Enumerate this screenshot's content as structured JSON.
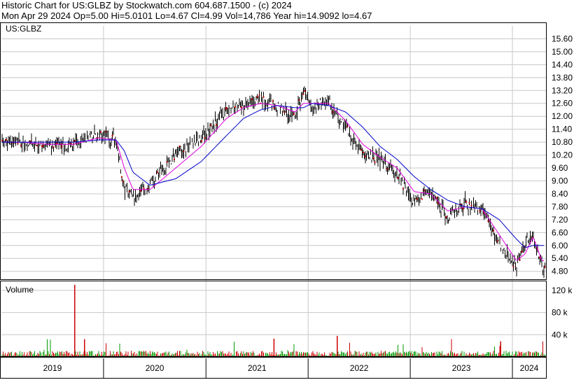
{
  "header": {
    "line1": "Historic Chart for US:GLBZ by Stockwatch.com 604.687.1500 - (c) 2024",
    "line2": "Mon Apr 29 2024  Op=5.00  Hi=5.0101  Lo=4.67  Cl=4.99  Vol=14,786  Year hi=14.9092  lo=4.67"
  },
  "colors": {
    "price_bar": "#000000",
    "down_dot": "#cc0000",
    "ma_short": "#e000e0",
    "ma_long": "#0000cc",
    "vol_up": "#009900",
    "vol_down": "#cc0000",
    "grid": "#c8c8c8"
  },
  "chart_data": [
    {
      "type": "line",
      "panel": "price",
      "label": "US:GLBZ",
      "y_ticks": [
        "15.60",
        "15.00",
        "14.40",
        "13.80",
        "13.20",
        "12.60",
        "12.00",
        "11.40",
        "10.80",
        "10.20",
        "9.60",
        "9.00",
        "8.40",
        "7.80",
        "7.20",
        "6.60",
        "6.00",
        "5.40",
        "4.80"
      ],
      "ylim": [
        4.4,
        16.2
      ],
      "x_ticks": [
        "2019",
        "2020",
        "2021",
        "2022",
        "2023",
        "2024"
      ],
      "x": [
        "2019-03",
        "2019-06",
        "2019-09",
        "2019-12",
        "2020-02",
        "2020-03",
        "2020-04",
        "2020-06",
        "2020-09",
        "2020-12",
        "2021-03",
        "2021-05",
        "2021-07",
        "2021-09",
        "2021-11",
        "2021-12",
        "2022-01",
        "2022-03",
        "2022-05",
        "2022-07",
        "2022-09",
        "2022-11",
        "2023-01",
        "2023-03",
        "2023-05",
        "2023-07",
        "2023-09",
        "2023-11",
        "2024-01",
        "2024-02",
        "2024-03",
        "2024-04"
      ],
      "series": [
        {
          "values": [
            10.8,
            10.6,
            10.7,
            11.2,
            10.9,
            8.6,
            8.3,
            8.8,
            10.3,
            11.0,
            12.3,
            12.5,
            12.8,
            12.4,
            12.0,
            13.2,
            12.4,
            12.7,
            11.5,
            10.3,
            10.0,
            9.3,
            8.0,
            8.6,
            7.2,
            8.0,
            7.6,
            6.0,
            5.0,
            6.1,
            6.4,
            5.0
          ]
        },
        {
          "values": [
            10.8,
            10.7,
            10.7,
            11.0,
            10.9,
            9.6,
            8.6,
            8.6,
            9.6,
            10.6,
            11.9,
            12.4,
            12.6,
            12.5,
            12.2,
            12.6,
            12.6,
            12.6,
            11.8,
            10.7,
            10.1,
            9.6,
            8.5,
            8.4,
            7.6,
            7.8,
            7.7,
            6.5,
            5.3,
            5.6,
            6.4,
            5.3
          ]
        },
        {
          "values": [
            10.8,
            10.8,
            10.8,
            10.9,
            10.9,
            10.4,
            9.4,
            8.8,
            9.1,
            9.9,
            11.1,
            11.9,
            12.3,
            12.5,
            12.4,
            12.4,
            12.6,
            12.5,
            12.2,
            11.5,
            10.6,
            10.0,
            9.2,
            8.6,
            8.1,
            7.8,
            7.7,
            7.2,
            6.3,
            5.9,
            6.0,
            6.0
          ]
        }
      ]
    },
    {
      "type": "bar",
      "panel": "volume",
      "label": "Volume",
      "y_ticks": [
        "120 k",
        "80 k",
        "40 k"
      ],
      "ylim": [
        0,
        135000
      ]
    }
  ]
}
